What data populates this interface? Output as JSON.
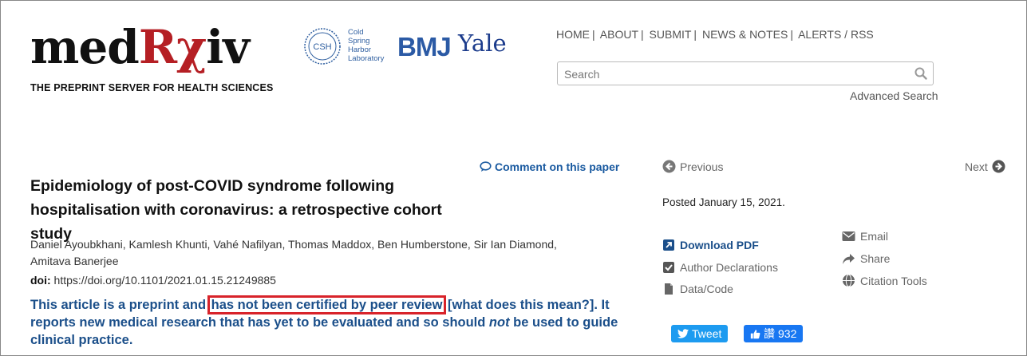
{
  "header": {
    "logo_prefix": "med",
    "logo_rx": "Rχ",
    "logo_suffix": "iv",
    "tagline": "THE PREPRINT SERVER FOR HEALTH SCIENCES",
    "partners": {
      "csh_badge": "CSH",
      "csh_lines": [
        "Cold",
        "Spring",
        "Harbor",
        "Laboratory"
      ],
      "bmj": "BMJ",
      "yale": "Yale"
    }
  },
  "nav": {
    "items": [
      "HOME",
      "ABOUT",
      "SUBMIT",
      "NEWS & NOTES",
      "ALERTS / RSS"
    ],
    "search_placeholder": "Search",
    "advanced_search": "Advanced Search"
  },
  "article": {
    "comment_link": "Comment on this paper",
    "title": "Epidemiology of post-COVID syndrome following hospitalisation with coronavirus: a retrospective cohort study",
    "authors": "Daniel Ayoubkhani, Kamlesh Khunti, Vahé Nafilyan, Thomas Maddox, Ben Humberstone, Sir Ian Diamond, Amitava Banerjee",
    "doi_label": "doi:",
    "doi_value": "https://doi.org/10.1101/2021.01.15.21249885",
    "notice_part1": "This article is a preprint and ",
    "notice_highlight": "has not been certified by peer review",
    "notice_part2": " [what does this mean?]. It reports new medical research that has yet to be evaluated and so should ",
    "notice_not": "not",
    "notice_part3": " be used to guide clinical practice."
  },
  "sidebar": {
    "previous": "Previous",
    "next": "Next",
    "posted": "Posted January 15, 2021.",
    "download_pdf": "Download PDF",
    "author_declarations": "Author Declarations",
    "data_code": "Data/Code",
    "email": "Email",
    "share": "Share",
    "citation_tools": "Citation Tools",
    "tweet": "Tweet",
    "like_label": "讚",
    "like_count": "932"
  },
  "colors": {
    "brand_red": "#b51f24",
    "link_blue": "#1b4f8a",
    "highlight_box": "#d8232a",
    "twitter": "#1d9bf0",
    "facebook": "#1877f2"
  }
}
